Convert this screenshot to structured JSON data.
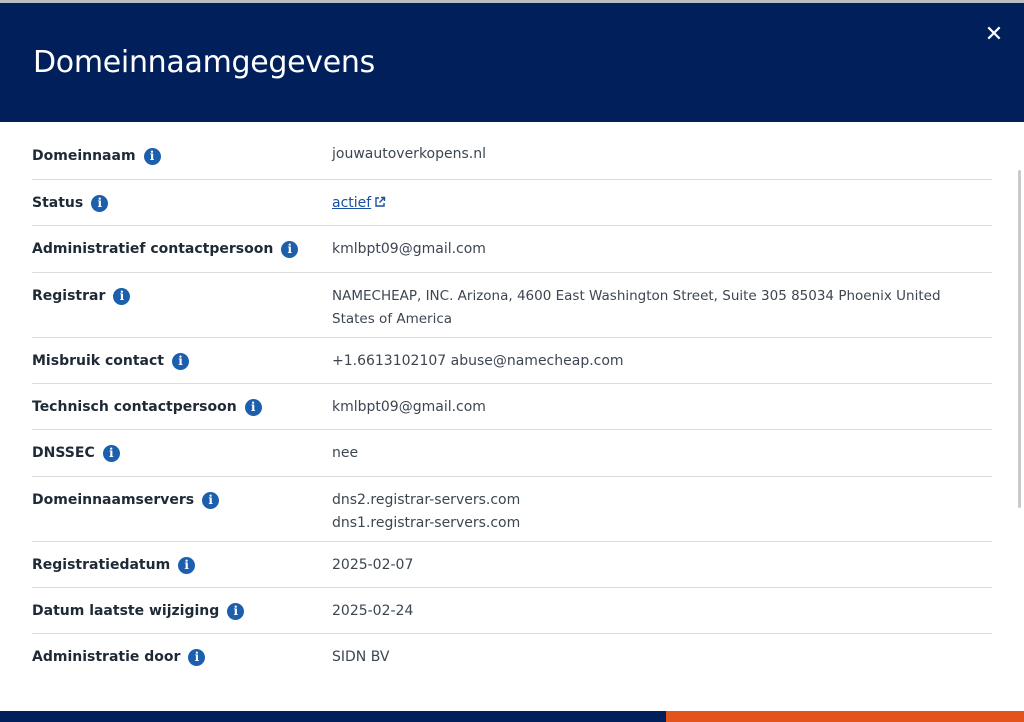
{
  "dialog": {
    "title": "Domeinnaamgegevens",
    "close_label": "✕"
  },
  "rows": [
    {
      "label": "Domeinnaam",
      "lines": [
        "jouwautoverkopens.nl"
      ]
    },
    {
      "label": "Status",
      "link": "actief"
    },
    {
      "label": "Administratief contactpersoon",
      "lines": [
        "kmlbpt09@gmail.com"
      ]
    },
    {
      "label": "Registrar",
      "lines": [
        "NAMECHEAP, INC. Arizona, 4600 East Washington Street, Suite 305 85034 Phoenix United States of America"
      ]
    },
    {
      "label": "Misbruik contact",
      "lines": [
        "+1.6613102107 abuse@namecheap.com"
      ]
    },
    {
      "label": "Technisch contactpersoon",
      "lines": [
        "kmlbpt09@gmail.com"
      ]
    },
    {
      "label": "DNSSEC",
      "lines": [
        "nee"
      ]
    },
    {
      "label": "Domeinnaamservers",
      "lines": [
        "dns2.registrar-servers.com",
        "dns1.registrar-servers.com"
      ]
    },
    {
      "label": "Registratiedatum",
      "lines": [
        "2025-02-07"
      ]
    },
    {
      "label": "Datum laatste wijziging",
      "lines": [
        "2025-02-24"
      ]
    },
    {
      "label": "Administratie door",
      "lines": [
        "SIDN BV"
      ]
    }
  ],
  "icons": {
    "info": "info-icon",
    "info_glyph": "i",
    "external": "external-link-icon",
    "close": "close-icon"
  },
  "colors": {
    "header": "#01205b",
    "accent_orange": "#e2541b",
    "info_icon": "#1c5fad",
    "link": "#1a4fa0"
  }
}
